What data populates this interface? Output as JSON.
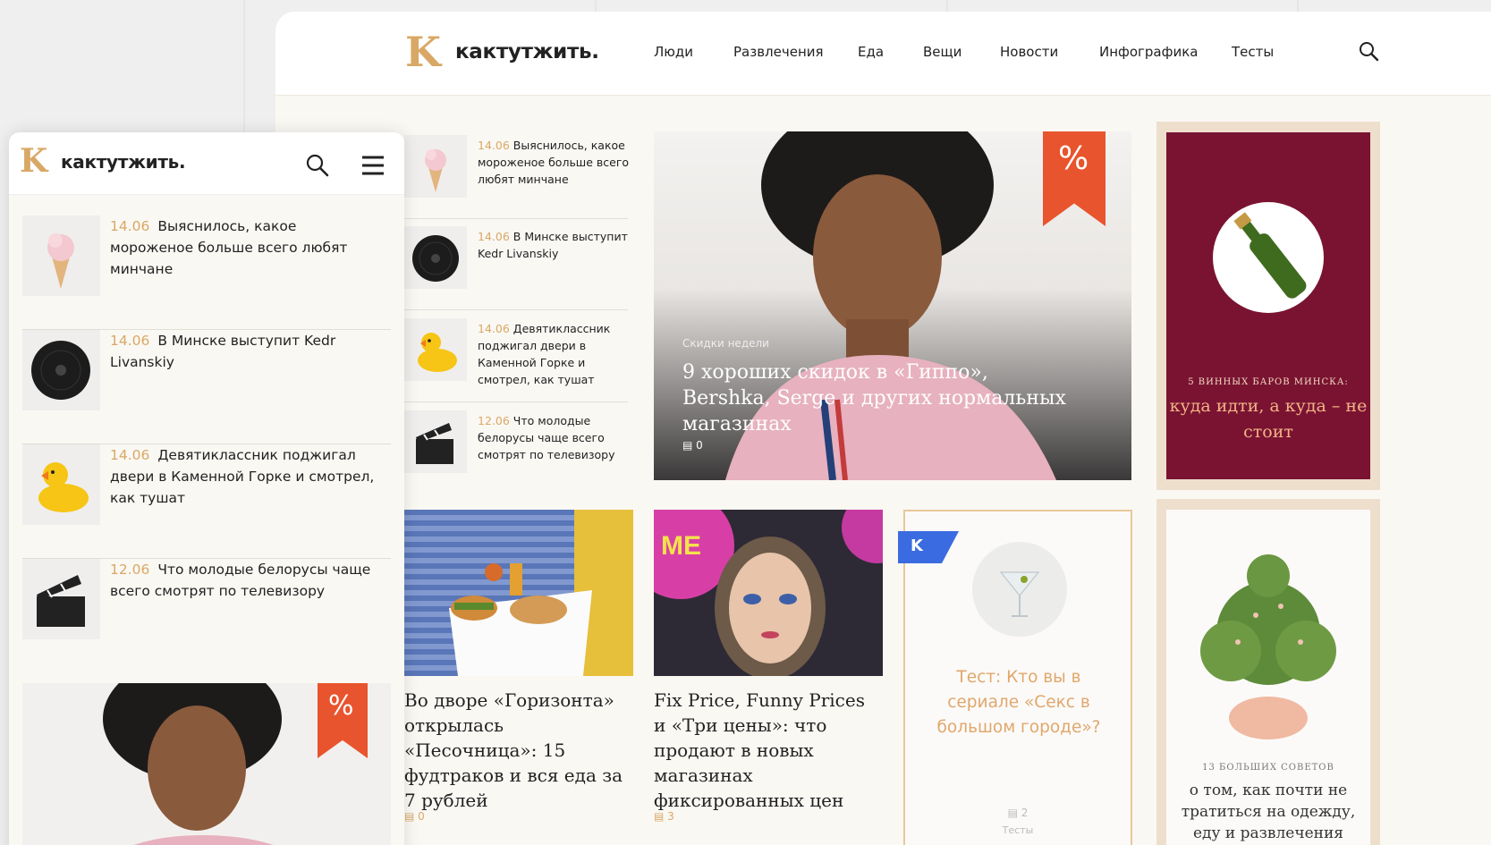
{
  "brand": {
    "logo_letter": "K",
    "name": "кактутжить."
  },
  "nav": [
    "Люди",
    "Развлечения",
    "Еда",
    "Вещи",
    "Новости",
    "Инфографика",
    "Тесты"
  ],
  "news": [
    {
      "date": "14.06",
      "text": "Выяснилось, какое мороженое больше всего любят минчане",
      "desktop_text": "Выяснилось, какое мороженое больше всего любят минчане",
      "icon": "ice-cream-icon"
    },
    {
      "date": "14.06",
      "text": "В Минске выступит Kedr Livanskiy",
      "desktop_text": "В Минске выступит Kedr Livanskiy",
      "icon": "vinyl-record-icon"
    },
    {
      "date": "14.06",
      "text": "Девятиклассник поджигал двери в Каменной Горке и смотрел, как тушат",
      "desktop_text": "Девятиклассник поджигал двери в Каменной Горке и смотрел, как тушат",
      "icon": "rubber-duck-icon"
    },
    {
      "date": "12.06",
      "text": "Что молодые белорусы чаще всего смотрят по телевизору",
      "desktop_text": "Что молодые белорусы чаще всего смотрят по телевизору",
      "icon": "clapperboard-icon"
    }
  ],
  "hero": {
    "kicker": "Скидки недели",
    "title": "9 хороших скидок в «Гиппо», Bershka, Serge и других нормальных магазинах",
    "comments": "0",
    "badge": "%"
  },
  "ad_wine": {
    "kicker": "5 ВИННЫХ БАРОВ МИНСКА:",
    "title": "куда идти, а куда – не стоит"
  },
  "ad_cactus": {
    "kicker": "13 БОЛЬШИХ СОВЕТОВ",
    "title": "о том, как почти не тратиться на одежду, еду и развлечения"
  },
  "cards": [
    {
      "title": "Во дворе «Горизонта» открылась «Песочница»: 15 фудтраков и вся еда за 7 рублей",
      "comments": "0"
    },
    {
      "title": "Fix Price, Funny Prices и «Три цены»: что продают в новых магазинах фиксированных цен",
      "comments": "3"
    }
  ],
  "test_card": {
    "badge": "K",
    "title": "Тест: Кто вы в сериале «Секс в большом городе»?",
    "comments": "2",
    "tag": "Тесты"
  },
  "colors": {
    "accent": "#d9a866",
    "ribbon": "#e8542d",
    "wine_bg": "#7a1332",
    "test_badge": "#3a6be0"
  }
}
